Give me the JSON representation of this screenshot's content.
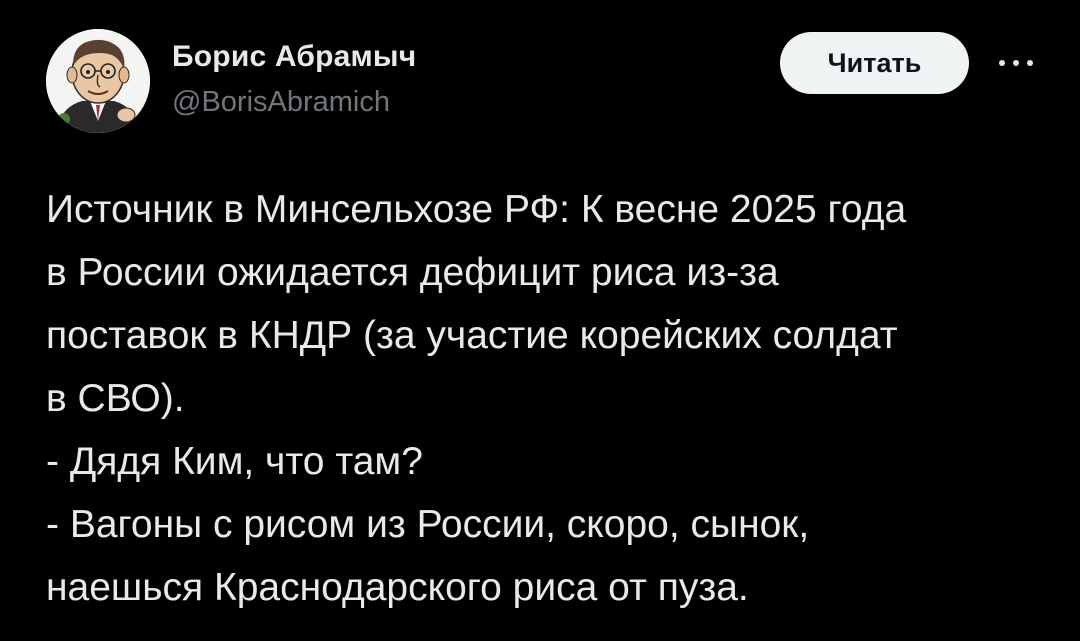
{
  "author": {
    "name": "Борис Абрамыч",
    "handle": "@BorisAbramich",
    "avatar_icon": "caricature-avatar-icon"
  },
  "actions": {
    "follow_label": "Читать",
    "more_icon": "more-horizontal-icon"
  },
  "tweet": {
    "lines": [
      "Источник в Минсельхозе РФ: К весне 2025 года",
      "в России ожидается дефицит риса из-за",
      "поставок в КНДР (за участие корейских солдат",
      "в СВО).",
      "- Дядя Ким, что там?",
      "- Вагоны с рисом из России, скоро, сынок,",
      "наешься Краснодарского риса от пуза."
    ]
  },
  "colors": {
    "background": "#000000",
    "text_primary": "#e7e9ea",
    "text_secondary": "#71767b",
    "button_bg": "#eff3f4",
    "button_text": "#0f1419"
  }
}
